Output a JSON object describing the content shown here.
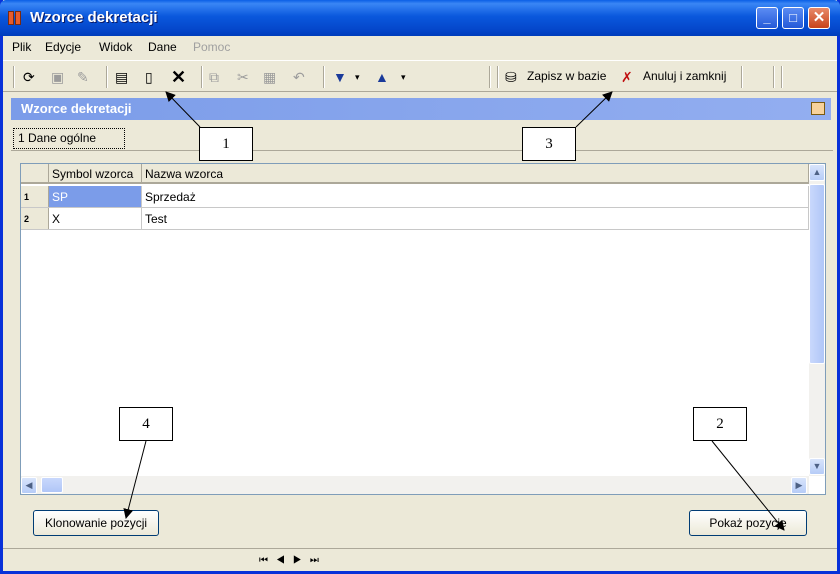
{
  "window": {
    "title": "Wzorce dekretacji"
  },
  "menu": [
    {
      "label": "Plik",
      "enabled": true
    },
    {
      "label": "Edycje",
      "enabled": true
    },
    {
      "label": "Widok",
      "enabled": true
    },
    {
      "label": "Dane",
      "enabled": true
    },
    {
      "label": "Pomoc",
      "enabled": false
    }
  ],
  "toolbar": {
    "save_label": "Zapisz w bazie",
    "cancel_close_label": "Anuluj i zamknij"
  },
  "section": {
    "title": "Wzorce dekretacji"
  },
  "tabs": [
    {
      "label": "1 Dane ogólne"
    }
  ],
  "grid": {
    "columns": [
      "Symbol wzorca",
      "Nazwa wzorca"
    ],
    "rows": [
      {
        "num": "1",
        "symbol": "SP",
        "name": "Sprzedaż"
      },
      {
        "num": "2",
        "symbol": "X",
        "name": "Test"
      }
    ]
  },
  "buttons": {
    "clone_label": "Klonowanie pozycji",
    "show_label": "Pokaż pozycje"
  },
  "callouts": [
    "1",
    "2",
    "3",
    "4"
  ],
  "colors": {
    "title_bar": "#0a58dd",
    "selection": "#7b9ce9",
    "section_bar": "#7b9ce9"
  }
}
